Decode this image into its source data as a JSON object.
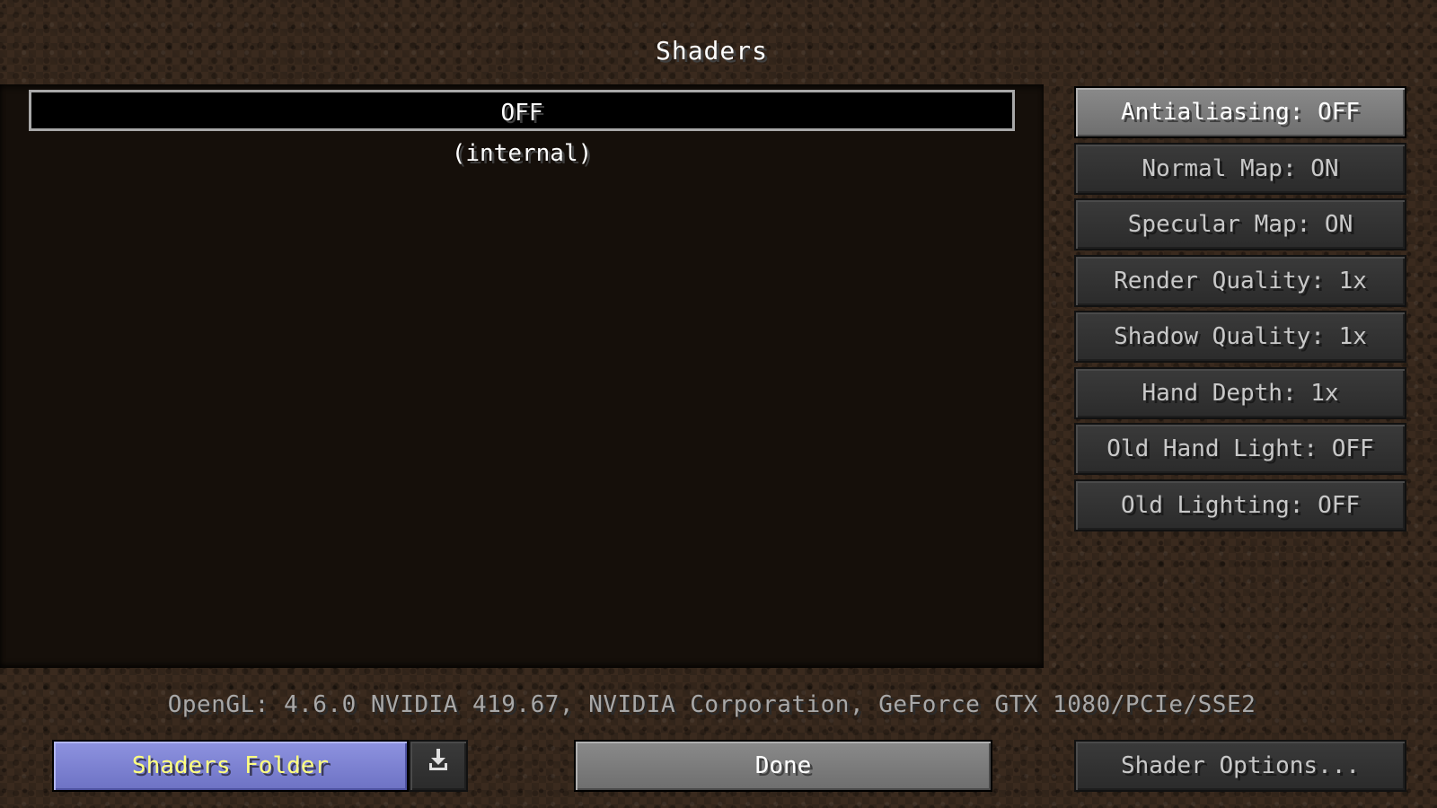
{
  "screen": {
    "title": "Shaders"
  },
  "shader_list": {
    "items": [
      {
        "label": "OFF",
        "selected": true
      },
      {
        "label": "(internal)",
        "selected": false
      }
    ]
  },
  "settings": {
    "antialiasing": "Antialiasing: OFF",
    "normal_map": "Normal Map: ON",
    "specular_map": "Specular Map: ON",
    "render_quality": "Render Quality: 1x",
    "shadow_quality": "Shadow Quality: 1x",
    "hand_depth": "Hand Depth: 1x",
    "old_hand_light": "Old Hand Light: OFF",
    "old_lighting": "Old Lighting: OFF"
  },
  "info": {
    "opengl": "OpenGL: 4.6.0 NVIDIA 419.67, NVIDIA Corporation, GeForce GTX 1080/PCIe/SSE2"
  },
  "footer": {
    "shaders_folder": "Shaders Folder",
    "download_icon": "download-icon",
    "done": "Done",
    "shader_options": "Shader Options..."
  },
  "colors": {
    "folder_button": "#7c81d4",
    "folder_text": "#ffff80",
    "done_button": "#7c7c7c"
  }
}
